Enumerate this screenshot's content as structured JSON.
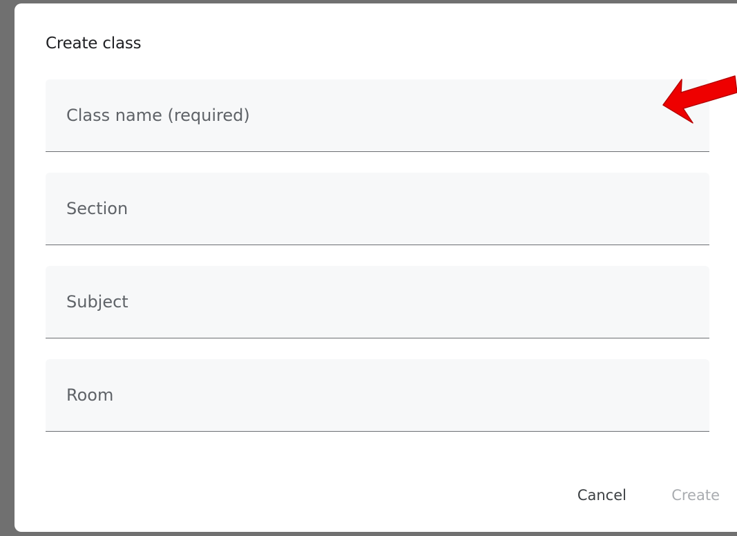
{
  "dialog": {
    "title": "Create class",
    "fields": [
      {
        "placeholder": "Class name (required)",
        "value": ""
      },
      {
        "placeholder": "Section",
        "value": ""
      },
      {
        "placeholder": "Subject",
        "value": ""
      },
      {
        "placeholder": "Room",
        "value": ""
      }
    ],
    "actions": {
      "cancel_label": "Cancel",
      "create_label": "Create"
    }
  },
  "annotation": {
    "icon": "red-arrow-icon",
    "color": "#ee0000"
  }
}
